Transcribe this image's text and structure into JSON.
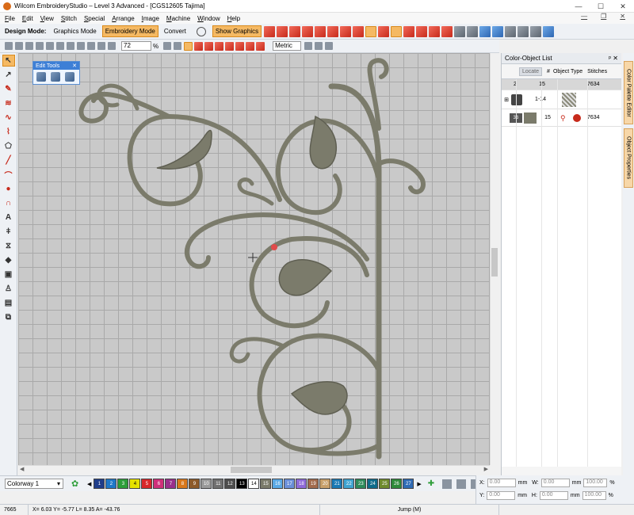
{
  "window": {
    "title": "Wilcom EmbroideryStudio – Level 3 Advanced - [CGS12605 Tajima]",
    "minimize": "—",
    "maximize": "☐",
    "close": "✕"
  },
  "menu": [
    "File",
    "Edit",
    "View",
    "Stitch",
    "Special",
    "Arrange",
    "Image",
    "Machine",
    "Window",
    "Help"
  ],
  "toolbar": {
    "design_mode_label": "Design Mode:",
    "graphics_mode": "Graphics Mode",
    "embroidery_mode": "Embroidery Mode",
    "convert": "Convert",
    "show_graphics": "Show Graphics"
  },
  "toolbar2": {
    "zoom_value": "72",
    "zoom_unit": "%",
    "units": "Metric"
  },
  "edit_tools": {
    "title": "Edit Tools",
    "close": "✕"
  },
  "color_object_list": {
    "title": "Color-Object List",
    "locate_button": "Locate",
    "columns": [
      "#",
      "Object Type",
      "Stitches"
    ],
    "rows": [
      {
        "left": "2",
        "num": "15",
        "type": "",
        "stitches": "7634"
      },
      {
        "left": "⊞",
        "num": "1-14",
        "type": "",
        "stitches": ""
      },
      {
        "left": "36",
        "num": "15",
        "type": "",
        "stitches": "7634"
      }
    ]
  },
  "side_tabs": {
    "color_palette": "Color Palette Editor",
    "object_properties": "Object Properties"
  },
  "colorway": {
    "label": "Colorway 1",
    "swatches": [
      {
        "n": "1",
        "color": "#1f3d8a"
      },
      {
        "n": "2",
        "color": "#1f78c8"
      },
      {
        "n": "3",
        "color": "#2e9e3a"
      },
      {
        "n": "4",
        "color": "#e6e200"
      },
      {
        "n": "5",
        "color": "#d8262a"
      },
      {
        "n": "6",
        "color": "#cf2f7a"
      },
      {
        "n": "7",
        "color": "#9a2f8c"
      },
      {
        "n": "8",
        "color": "#d9781c"
      },
      {
        "n": "9",
        "color": "#8c5a2a"
      },
      {
        "n": "10",
        "color": "#9a9a9a"
      },
      {
        "n": "11",
        "color": "#707070"
      },
      {
        "n": "12",
        "color": "#4d4d4d"
      },
      {
        "n": "13",
        "color": "#000000"
      },
      {
        "n": "14",
        "color": "#ffffff"
      },
      {
        "n": "15",
        "color": "#7b7b6b"
      },
      {
        "n": "16",
        "color": "#5aa9e6"
      },
      {
        "n": "17",
        "color": "#6b8fd8"
      },
      {
        "n": "18",
        "color": "#8f6bd8"
      },
      {
        "n": "19",
        "color": "#a26b4d"
      },
      {
        "n": "20",
        "color": "#c8a06b"
      },
      {
        "n": "21",
        "color": "#1b7ab5"
      },
      {
        "n": "22",
        "color": "#3fa3d0"
      },
      {
        "n": "23",
        "color": "#2d8a5a"
      },
      {
        "n": "24",
        "color": "#0f6b8a"
      },
      {
        "n": "25",
        "color": "#6e8a2d"
      },
      {
        "n": "26",
        "color": "#2f8a3a"
      },
      {
        "n": "27",
        "color": "#2f6bb5"
      }
    ]
  },
  "coords": {
    "x_label": "X:",
    "x_val": "0.00",
    "x_unit": "mm",
    "w_label": "W:",
    "w_val": "0.00",
    "w_unit": "mm",
    "w_pct": "100.00",
    "y_label": "Y:",
    "y_val": "0.00",
    "y_unit": "mm",
    "h_label": "H:",
    "h_val": "0.00",
    "h_unit": "mm",
    "h_pct": "100.00",
    "pct": "%"
  },
  "status": {
    "stitch_count": "7665",
    "position": "X=  6.03 Y= -5.77 L=  8.35 A= -43.76",
    "mode": "Jump (M)"
  },
  "colors": {
    "thread": "#7b7b6b",
    "thread_dark": "#5f5f52",
    "canvas": "#c9c9c9",
    "accent": "#f5b963"
  }
}
